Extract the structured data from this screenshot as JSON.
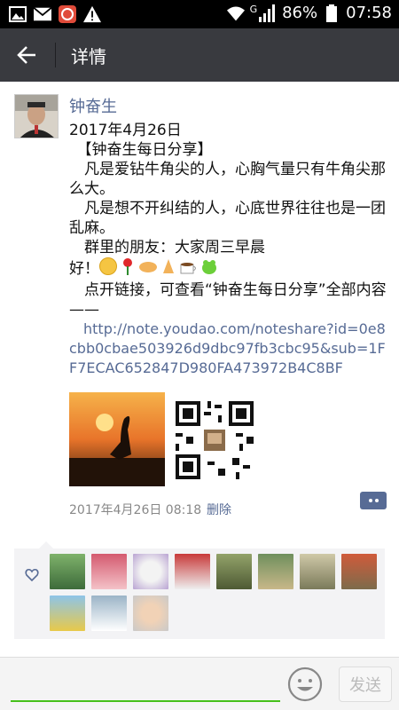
{
  "status_bar": {
    "network_label": "G",
    "battery": "86%",
    "time": "07:58",
    "icons": [
      "gallery-icon",
      "mail-icon",
      "app-badge-icon",
      "warning-icon",
      "wifi-icon",
      "signal-icon",
      "battery-icon"
    ]
  },
  "titlebar": {
    "title": "详情",
    "back_icon": "back-arrow-icon"
  },
  "post": {
    "author": "钟奋生",
    "lines": [
      "2017年4月26日",
      "　【钟奋生每日分享】",
      "　凡是爱钻牛角尖的人，心胸气量只有牛角尖那么大。",
      "　凡是想不开纠结的人，心底世界往往也是一团乱麻。",
      "　群里的朋友：大家周三早晨好！",
      "　点开链接，可查看“钟奋生每日分享”全部内容——"
    ],
    "greeting_prefix": "　群里的朋友：大家周三早晨",
    "greeting_suffix": "好！",
    "link": "　http://note.youdao.com/noteshare?id=0e8cbb0cbae503926d9dbc97fb3cbc95&sub=1FF7ECAC652847D980FA473972B4C8BF",
    "emojis": [
      "smile-emoji",
      "rose-emoji",
      "handshake-emoji",
      "pray-emoji",
      "coffee-emoji",
      "frog-emoji"
    ],
    "timestamp": "2017年4月26日 08:18",
    "delete_label": "删除"
  },
  "likes": {
    "count_avatars": 11
  },
  "bottom": {
    "send_label": "发送"
  },
  "colors": {
    "link": "#576b95",
    "titlebar": "#393a3f",
    "accent_green": "#45c01a"
  }
}
